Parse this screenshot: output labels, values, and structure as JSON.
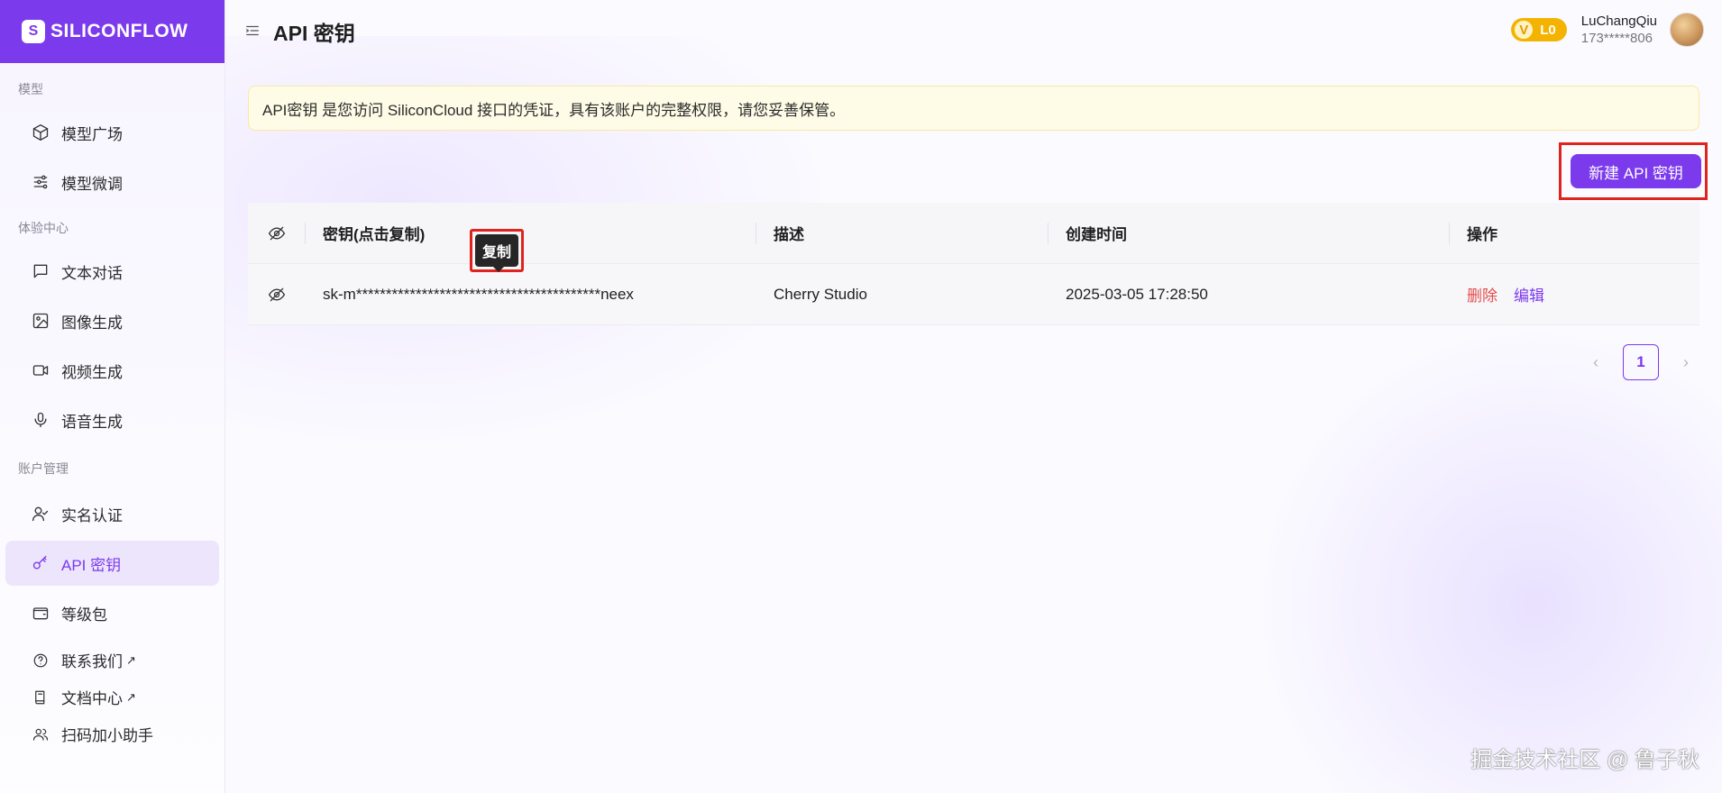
{
  "app": {
    "brand": "SILICONFLOW",
    "accent": "#7c3aed"
  },
  "sidebar": {
    "sections": [
      {
        "label": "模型",
        "items": [
          {
            "label": "模型广场",
            "icon": "cube-icon"
          },
          {
            "label": "模型微调",
            "icon": "sliders-icon"
          }
        ]
      },
      {
        "label": "体验中心",
        "items": [
          {
            "label": "文本对话",
            "icon": "chat-icon"
          },
          {
            "label": "图像生成",
            "icon": "image-icon"
          },
          {
            "label": "视频生成",
            "icon": "video-icon"
          },
          {
            "label": "语音生成",
            "icon": "microphone-icon"
          }
        ]
      },
      {
        "label": "账户管理",
        "items": [
          {
            "label": "实名认证",
            "icon": "user-check-icon"
          },
          {
            "label": "API 密钥",
            "icon": "key-icon",
            "active": true
          },
          {
            "label": "等级包",
            "icon": "wallet-icon"
          }
        ]
      }
    ],
    "footer_items": [
      {
        "label": "联系我们",
        "icon": "help-circle-icon",
        "external": "↗"
      },
      {
        "label": "文档中心",
        "icon": "book-icon",
        "external": "↗"
      },
      {
        "label": "扫码加小助手",
        "icon": "users-icon"
      }
    ]
  },
  "header": {
    "title": "API 密钥",
    "vip_letter": "V",
    "level": "L0",
    "user_name": "LuChangQiu",
    "user_phone": "173*****806"
  },
  "notice": {
    "text": "API密钥 是您访问 SiliconCloud 接口的凭证，具有该账户的完整权限，请您妥善保管。"
  },
  "actions": {
    "new_key_label": "新建 API 密钥"
  },
  "table": {
    "columns": [
      "密钥(点击复制)",
      "描述",
      "创建时间",
      "操作"
    ],
    "rows": [
      {
        "key": "sk-m*****************************************neex",
        "description": "Cherry Studio",
        "created_at": "2025-03-05 17:28:50",
        "delete_label": "删除",
        "edit_label": "编辑"
      }
    ],
    "tooltip": "复制"
  },
  "pagination": {
    "current_page": "1",
    "prev": "‹",
    "next": "›"
  },
  "watermark": "掘金技术社区 @ 鲁子秋"
}
